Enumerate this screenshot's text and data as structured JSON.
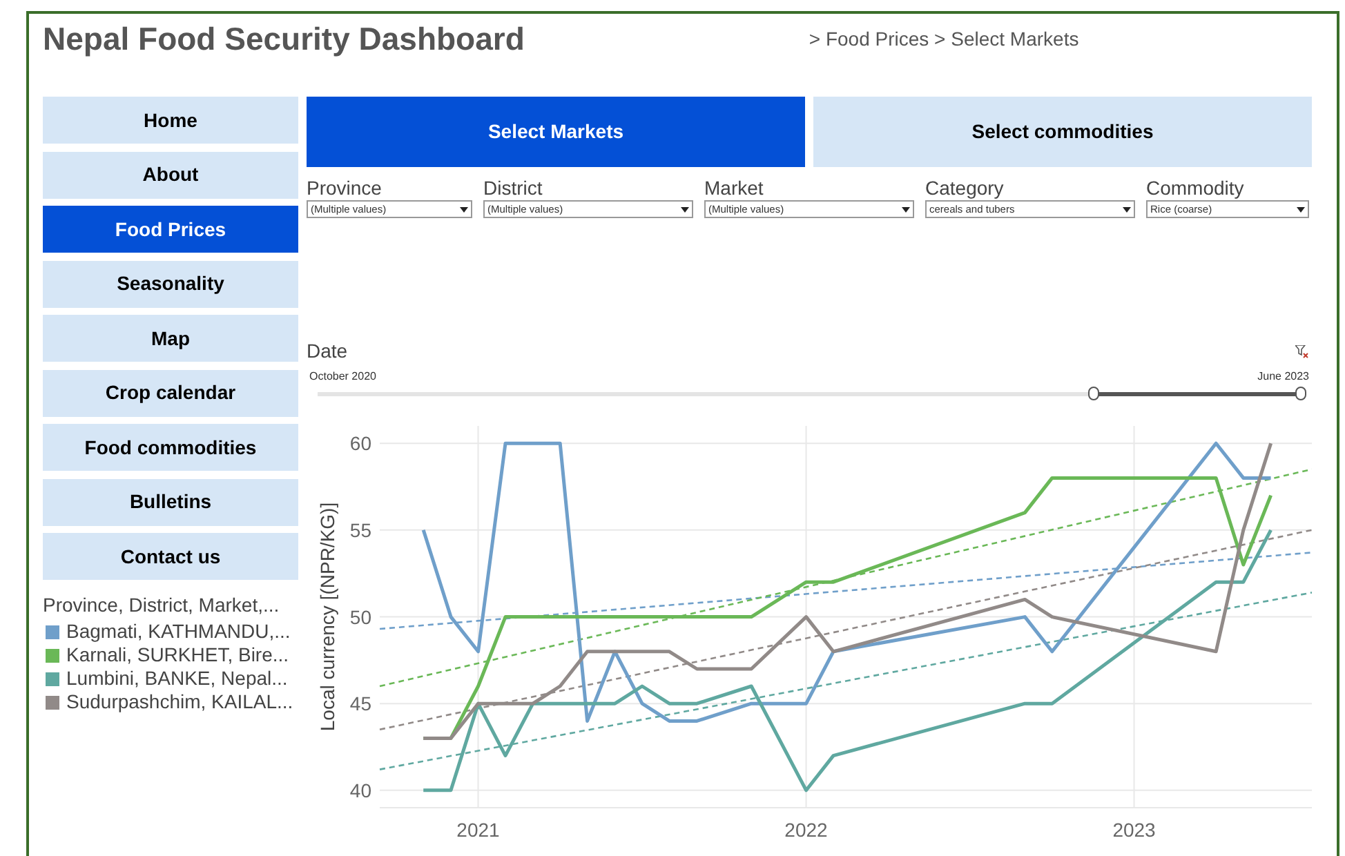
{
  "title": "Nepal Food Security Dashboard",
  "breadcrumb": "> Food Prices > Select Markets",
  "nav": [
    {
      "label": "Home",
      "selected": false
    },
    {
      "label": "About",
      "selected": false
    },
    {
      "label": "Food Prices",
      "selected": true
    },
    {
      "label": "Seasonality",
      "selected": false
    },
    {
      "label": "Map",
      "selected": false
    },
    {
      "label": "Crop calendar",
      "selected": false
    },
    {
      "label": "Food commodities",
      "selected": false
    },
    {
      "label": "Bulletins",
      "selected": false
    },
    {
      "label": "Contact us",
      "selected": false
    }
  ],
  "tabs": [
    {
      "label": "Select Markets",
      "selected": true
    },
    {
      "label": "Select commodities",
      "selected": false
    }
  ],
  "filters": [
    {
      "label": "Province",
      "value": "(Multiple values)"
    },
    {
      "label": "District",
      "value": "(Multiple values)"
    },
    {
      "label": "Market",
      "value": "(Multiple values)"
    },
    {
      "label": "Category",
      "value": "cereals and tubers"
    },
    {
      "label": "Commodity",
      "value": "Rice (coarse)"
    }
  ],
  "legend": {
    "title": "Province, District, Market,..."
  },
  "date_filter": {
    "label": "Date",
    "start": "October 2020",
    "end": "June 2023",
    "handles": [
      {
        "level": 0.79
      },
      {
        "level": 1
      }
    ]
  },
  "chart_data": {
    "type": "line",
    "ylabel": "Local currency [(NPR/KG)]",
    "xlim": [
      2020.7,
      2023.542
    ],
    "ylim": [
      39,
      61
    ],
    "xticks": [
      2021,
      2022,
      2023
    ],
    "yticks": [
      40,
      45,
      50,
      55,
      60
    ],
    "grid": true,
    "series": [
      {
        "name": "Bagmati, KATHMANDU,...",
        "color": "#6f9fca",
        "x": [
          2020.833,
          2020.917,
          2021,
          2021.083,
          2021.167,
          2021.25,
          2021.333,
          2021.417,
          2021.5,
          2021.583,
          2021.667,
          2021.833,
          2022,
          2022.083,
          2022.667,
          2022.75,
          2023.25,
          2023.333,
          2023.417
        ],
        "values": [
          55,
          50,
          48,
          60,
          60,
          60,
          44,
          48,
          45,
          44,
          44,
          45,
          45,
          48,
          50,
          48,
          60,
          58,
          58
        ]
      },
      {
        "name": "Karnali, SURKHET, Bire...",
        "color": "#6ab857",
        "x": [
          2020.833,
          2020.917,
          2021,
          2021.083,
          2021.833,
          2022,
          2022.083,
          2022.667,
          2022.75,
          2023.25,
          2023.333,
          2023.417
        ],
        "values": [
          43,
          43,
          46,
          50,
          50,
          52,
          52,
          56,
          58,
          58,
          53,
          57
        ]
      },
      {
        "name": "Lumbini, BANKE, Nepal...",
        "color": "#5fa8a0",
        "x": [
          2020.833,
          2020.917,
          2021,
          2021.083,
          2021.167,
          2021.25,
          2021.333,
          2021.417,
          2021.5,
          2021.583,
          2021.667,
          2021.833,
          2022,
          2022.083,
          2022.667,
          2022.75,
          2023.25,
          2023.333,
          2023.417
        ],
        "values": [
          40,
          40,
          45,
          42,
          45,
          45,
          45,
          45,
          46,
          45,
          45,
          46,
          40,
          42,
          45,
          45,
          52,
          52,
          55
        ]
      },
      {
        "name": "Sudurpashchim, KAILAL...",
        "color": "#918a88",
        "x": [
          2020.833,
          2020.917,
          2021,
          2021.083,
          2021.167,
          2021.25,
          2021.333,
          2021.417,
          2021.583,
          2021.667,
          2021.833,
          2022,
          2022.083,
          2022.667,
          2022.75,
          2023.25,
          2023.333,
          2023.417
        ],
        "values": [
          43,
          43,
          45,
          45,
          45,
          46,
          48,
          48,
          48,
          47,
          47,
          50,
          48,
          51,
          50,
          48,
          55,
          60
        ]
      },
      {
        "line_style": "dashed",
        "color": "#6f9fca",
        "x": [
          2020.7,
          2023.542
        ],
        "values": [
          49.3,
          53.7
        ]
      },
      {
        "line_style": "dashed",
        "color": "#6ab857",
        "x": [
          2020.7,
          2023.542
        ],
        "values": [
          46.0,
          58.5
        ]
      },
      {
        "line_style": "dashed",
        "color": "#5fa8a0",
        "x": [
          2020.7,
          2023.542
        ],
        "values": [
          41.2,
          51.4
        ]
      },
      {
        "line_style": "dashed",
        "color": "#918a88",
        "x": [
          2020.7,
          2023.542
        ],
        "values": [
          43.5,
          55.0
        ]
      }
    ]
  }
}
